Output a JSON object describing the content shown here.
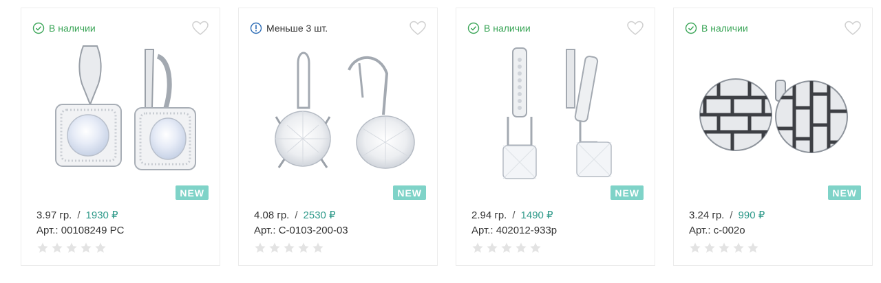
{
  "currency": "₽",
  "products": [
    {
      "stock": "В наличии",
      "stock_type": "in",
      "weight": "3.97 гр.",
      "price": "1930 ₽",
      "article": "Арт.: 00108249 PC",
      "badge": "NEW",
      "rating": 0,
      "image_icon": "opal-square-earrings-icon"
    },
    {
      "stock": "Меньше 3 шт.",
      "stock_type": "low",
      "weight": "4.08 гр.",
      "price": "2530 ₽",
      "article": "Арт.: С-0103-200-03",
      "badge": "NEW",
      "rating": 0,
      "image_icon": "crystal-round-earrings-icon"
    },
    {
      "stock": "В наличии",
      "stock_type": "in",
      "weight": "2.94 гр.",
      "price": "1490 ₽",
      "article": "Арт.: 402012-933р",
      "badge": "NEW",
      "rating": 0,
      "image_icon": "drop-crystal-earrings-icon"
    },
    {
      "stock": "В наличии",
      "stock_type": "in",
      "weight": "3.24 гр.",
      "price": "990 ₽",
      "article": "Арт.: с-002о",
      "badge": "NEW",
      "rating": 0,
      "image_icon": "round-pattern-earrings-icon"
    }
  ],
  "colors": {
    "in_stock": "#3aa557",
    "low_stock": "#2a6bb5",
    "price": "#2f9a8a",
    "badge": "#7fd3c8",
    "star": "#e3e3e3"
  }
}
